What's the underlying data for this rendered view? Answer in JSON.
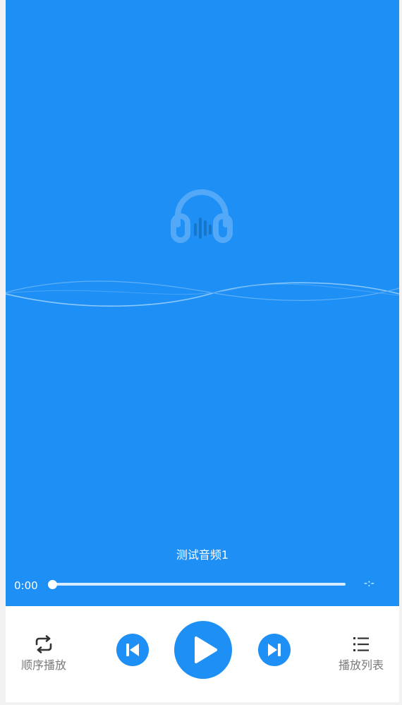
{
  "player": {
    "track_title": "测试音频1",
    "current_time": "0:00",
    "duration": "-:-",
    "progress": 0
  },
  "controls": {
    "mode_label": "顺序播放",
    "playlist_label": "播放列表"
  },
  "icons": {
    "cover": "headphone-icon",
    "mode": "repeat-icon",
    "prev": "skip-previous-icon",
    "play": "play-icon",
    "next": "skip-next-icon",
    "playlist": "list-icon"
  },
  "colors": {
    "accent": "#1e90f5",
    "label": "#7a7a7a",
    "icon_dark": "#333333"
  }
}
